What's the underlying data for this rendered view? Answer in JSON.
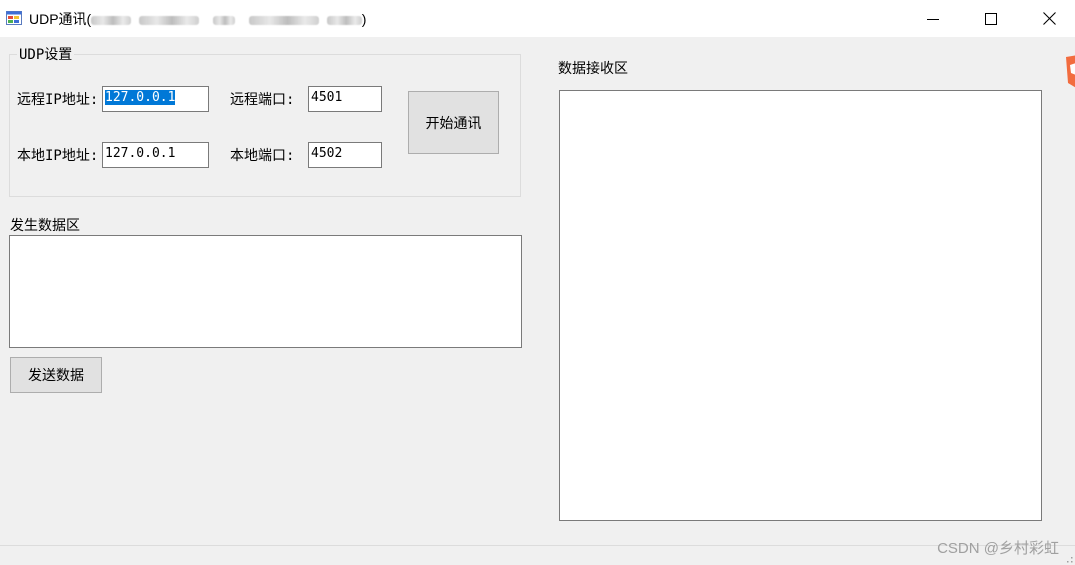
{
  "window": {
    "title": "UDP通讯(",
    "title_suffix": ")",
    "controls": {
      "minimize": "minimize-icon",
      "maximize": "maximize-icon",
      "close": "close-icon"
    }
  },
  "udp_settings": {
    "group_title": "UDP设置",
    "remote_ip_label": "远程IP地址:",
    "remote_ip_value": "127.0.0.1",
    "remote_port_label": "远程端口:",
    "remote_port_value": "4501",
    "local_ip_label": "本地IP地址:",
    "local_ip_value": "127.0.0.1",
    "local_port_label": "本地端口:",
    "local_port_value": "4502",
    "start_button": "开始通讯"
  },
  "send_area": {
    "label": "发生数据区",
    "value": "",
    "send_button": "发送数据"
  },
  "receive_area": {
    "label": "数据接收区",
    "value": ""
  },
  "watermark": "CSDN @乡村彩虹",
  "colors": {
    "selection": "#0078d7",
    "background": "#f0f0f0",
    "titlebar": "#ffffff"
  }
}
